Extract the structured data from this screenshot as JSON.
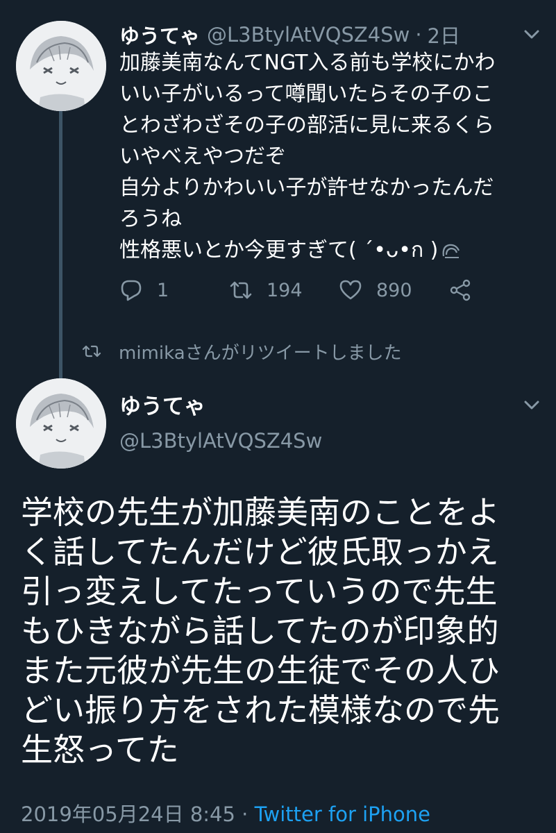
{
  "tweet1": {
    "name": "ゆうてゃ",
    "handle": "@L3BtylAtVQSZ4Sw",
    "separator": "·",
    "time": "2日",
    "text_lines": [
      "加藤美南なんてNGT入る前も学校にかわ",
      "いい子がいるって噂聞いたらその子のこ",
      "とわざわざその子の部活に見に来るくら",
      "いやべえやつだぞ",
      "自分よりかわいい子が許せなかったんだ",
      "ろうね",
      "性格悪いとか今更すぎて( ˊ•ᴗ•ก )"
    ],
    "emoji_icon": "sweat-drip-icon",
    "reply_count": "1",
    "retweet_count": "194",
    "like_count": "890"
  },
  "retweet_banner": {
    "text": "mimikaさんがリツイートしました"
  },
  "tweet2": {
    "name": "ゆうてゃ",
    "handle": "@L3BtylAtVQSZ4Sw",
    "text_lines": [
      "学校の先生が加藤美南のことをよ",
      "く話してたんだけど彼氏取っかえ",
      "引っ変えしてたっていうので先生",
      "もひきながら話してたのが印象的",
      "また元彼が先生の生徒でその人ひ",
      "どい振り方をされた模様なので先",
      "生怒ってた"
    ],
    "timestamp": "2019年05月24日 8:45",
    "separator": "·",
    "client": "Twitter for iPhone"
  },
  "colors": {
    "background": "#15202b",
    "text": "#ffffff",
    "secondary": "#8899a6",
    "accent": "#1da1f2",
    "thread_line": "#3d5466"
  }
}
